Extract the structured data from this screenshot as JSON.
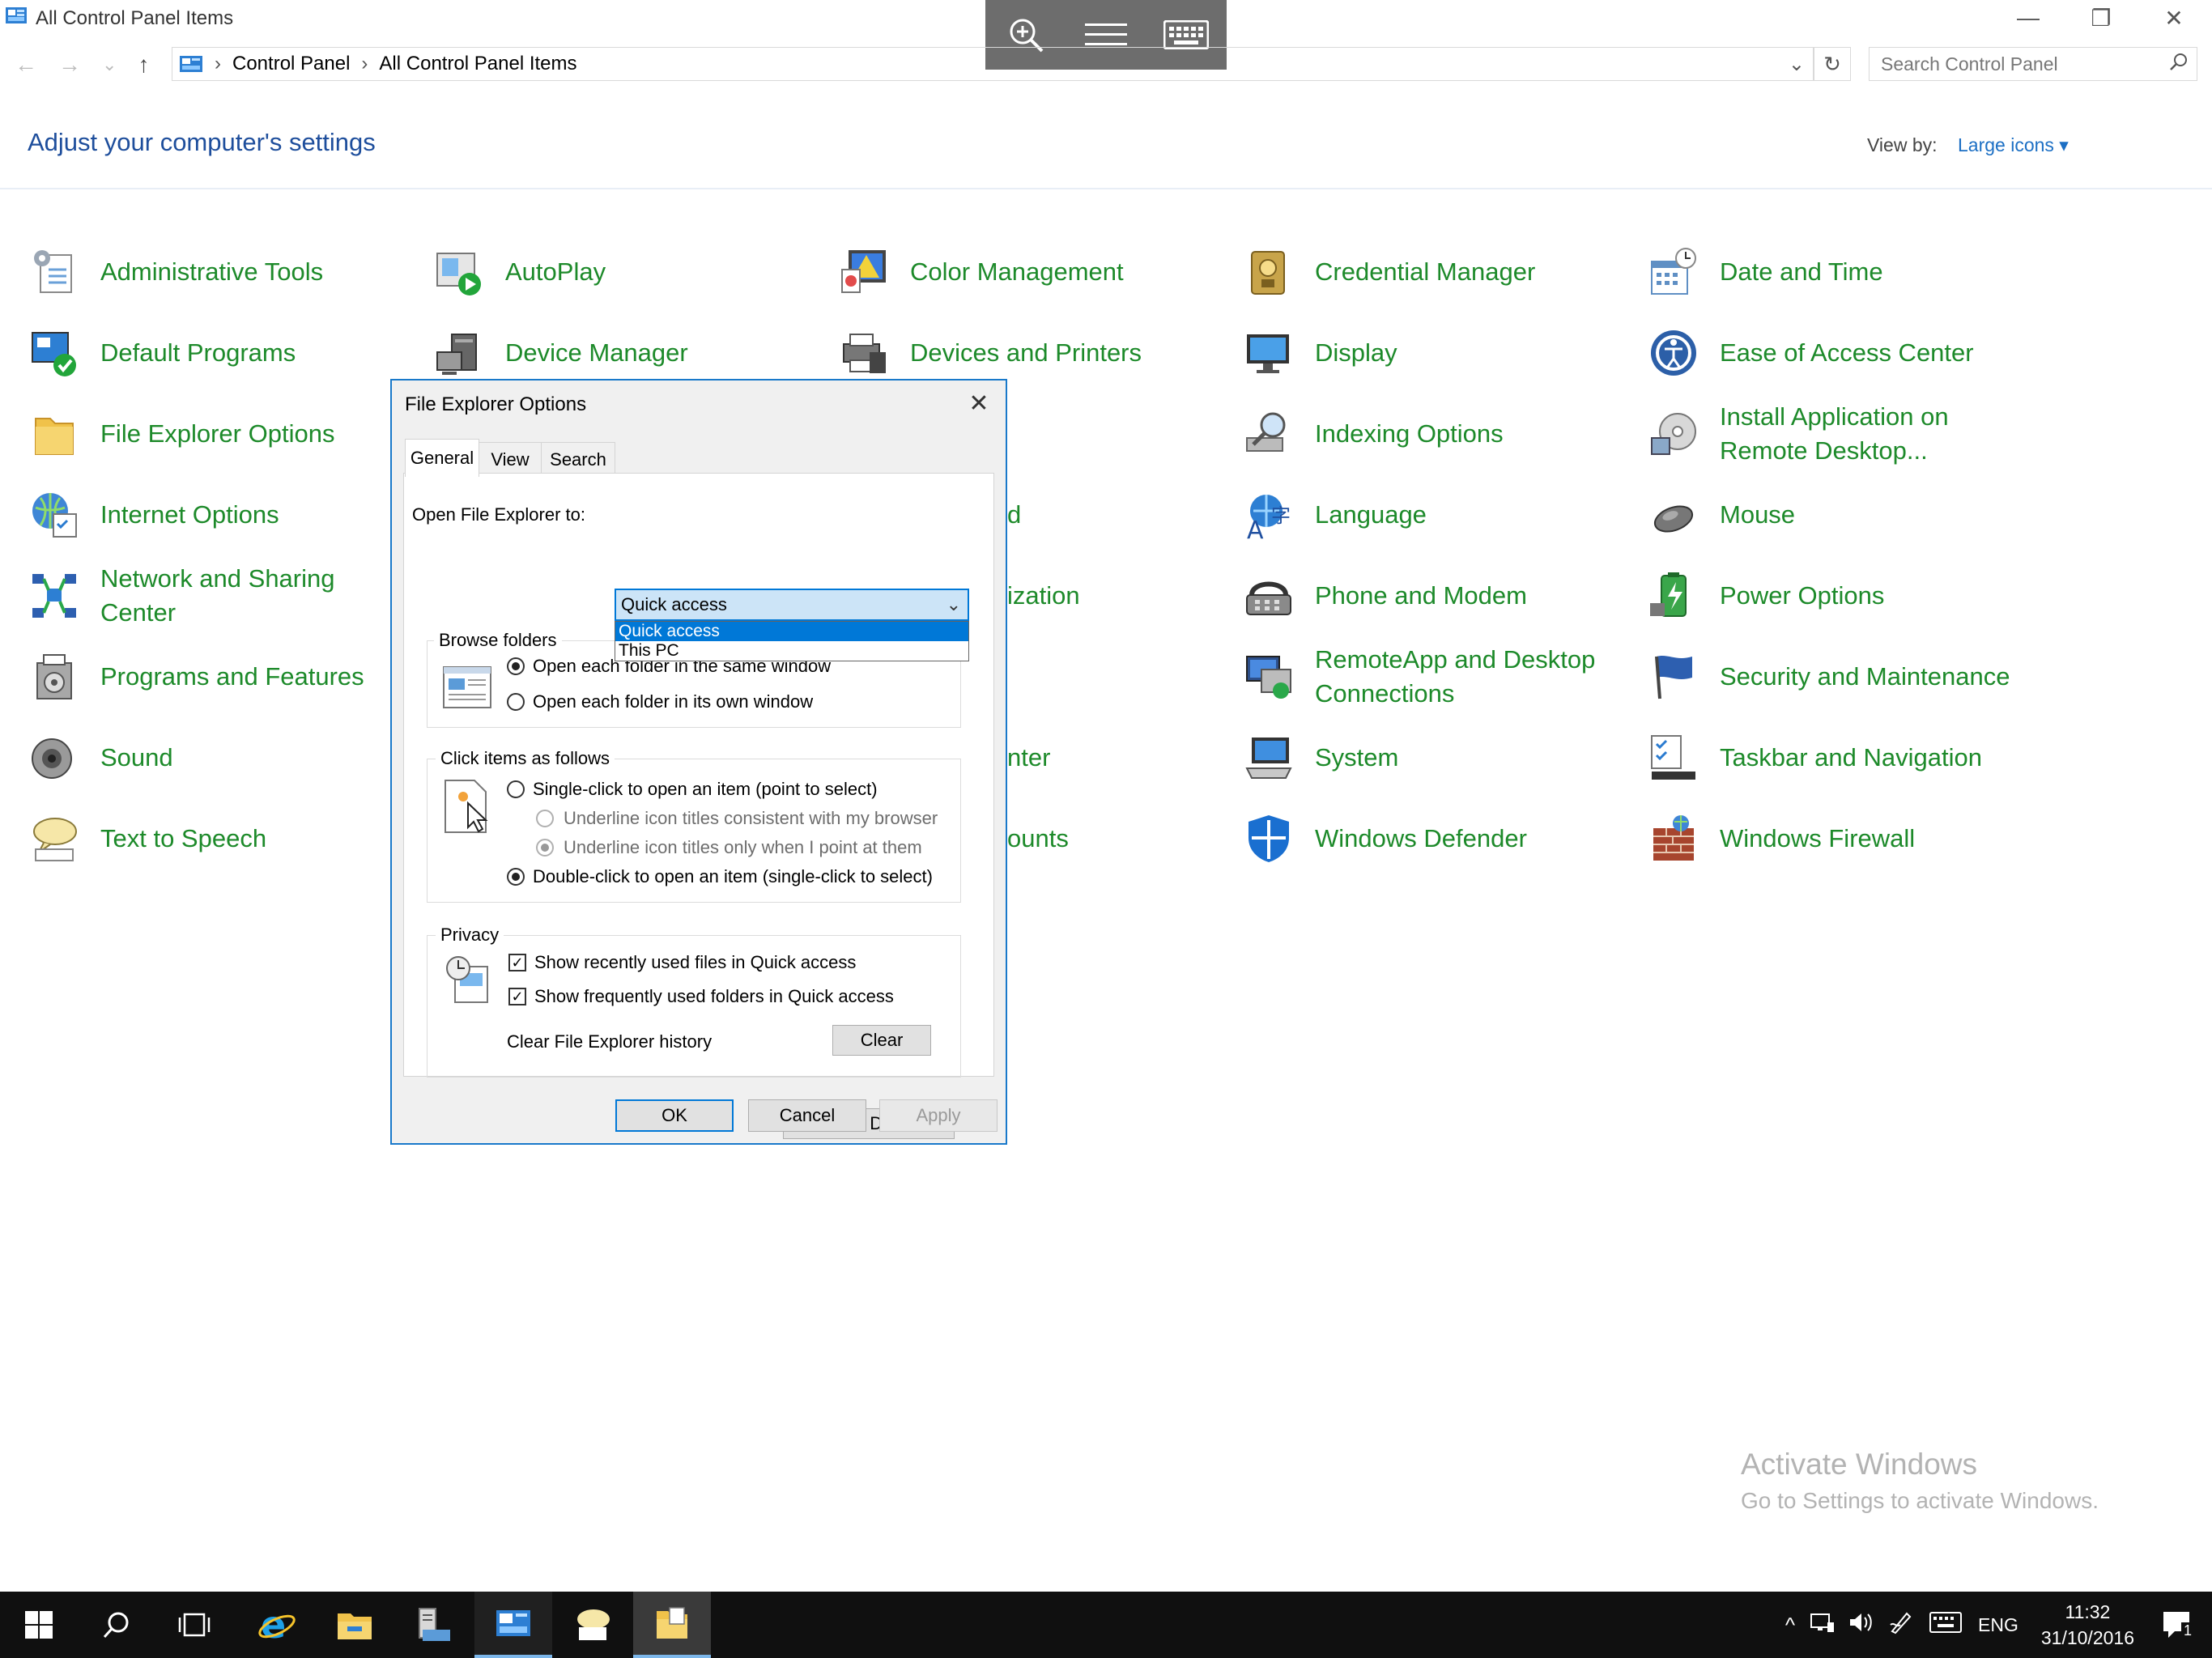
{
  "window": {
    "title": "All Control Panel Items",
    "minimize": "—",
    "restore": "❐",
    "close": "✕"
  },
  "address": {
    "back": "←",
    "forward": "→",
    "recent": "⌄",
    "up": "↑",
    "crumbs": [
      "Control Panel",
      "All Control Panel Items"
    ],
    "separator": "›",
    "dropdown": "⌄",
    "refresh": "↻",
    "search_placeholder": "Search Control Panel"
  },
  "header": {
    "title": "Adjust your computer's settings",
    "view_by_label": "View by:",
    "view_by_value": "Large icons ▾"
  },
  "items": [
    {
      "label": "Administrative Tools",
      "icon": "admin-tools-icon"
    },
    {
      "label": "AutoPlay",
      "icon": "autoplay-icon"
    },
    {
      "label": "Color Management",
      "icon": "color-management-icon"
    },
    {
      "label": "Credential Manager",
      "icon": "credential-manager-icon"
    },
    {
      "label": "Date and Time",
      "icon": "date-time-icon"
    },
    {
      "label": "Default Programs",
      "icon": "default-programs-icon"
    },
    {
      "label": "Device Manager",
      "icon": "device-manager-icon"
    },
    {
      "label": "Devices and Printers",
      "icon": "devices-printers-icon"
    },
    {
      "label": "Display",
      "icon": "display-icon"
    },
    {
      "label": "Ease of Access Center",
      "icon": "ease-of-access-icon"
    },
    {
      "label": "File Explorer Options",
      "icon": "file-explorer-options-icon"
    },
    {
      "label": "Indexing Options",
      "icon": "indexing-options-icon"
    },
    {
      "label": "Install Application on Remote Desktop...",
      "icon": "install-app-rd-icon"
    },
    {
      "label": "Internet Options",
      "icon": "internet-options-icon"
    },
    {
      "label": "d",
      "icon": ""
    },
    {
      "label": "Language",
      "icon": "language-icon"
    },
    {
      "label": "Mouse",
      "icon": "mouse-icon"
    },
    {
      "label": "Network and Sharing Center",
      "icon": "network-sharing-icon"
    },
    {
      "label": "ization",
      "icon": ""
    },
    {
      "label": "Phone and Modem",
      "icon": "phone-modem-icon"
    },
    {
      "label": "Power Options",
      "icon": "power-options-icon"
    },
    {
      "label": "Programs and Features",
      "icon": "programs-features-icon"
    },
    {
      "label": "RemoteApp and Desktop Connections",
      "icon": "remoteapp-icon"
    },
    {
      "label": "Security and Maintenance",
      "icon": "security-maintenance-icon"
    },
    {
      "label": "Sound",
      "icon": "sound-icon"
    },
    {
      "label": "nter",
      "icon": ""
    },
    {
      "label": "System",
      "icon": "system-icon"
    },
    {
      "label": "Taskbar and Navigation",
      "icon": "taskbar-navigation-icon"
    },
    {
      "label": "Text to Speech",
      "icon": "text-to-speech-icon"
    },
    {
      "label": "ounts",
      "icon": ""
    },
    {
      "label": "Windows Defender",
      "icon": "windows-defender-icon"
    },
    {
      "label": "Windows Firewall",
      "icon": "windows-firewall-icon"
    }
  ],
  "dialog": {
    "title": "File Explorer Options",
    "close": "✕",
    "tabs": [
      "General",
      "View",
      "Search"
    ],
    "open_to_label": "Open File Explorer to:",
    "open_to_value": "Quick access",
    "combo_arrow": "⌄",
    "open_to_options": [
      "Quick access",
      "This PC"
    ],
    "browse_folders": {
      "legend": "Browse folders",
      "opt_same": "Open each folder in the same window",
      "opt_own": "Open each folder in its own window"
    },
    "click_items": {
      "legend": "Click items as follows",
      "single": "Single-click to open an item (point to select)",
      "underline_browser": "Underline icon titles consistent with my browser",
      "underline_point": "Underline icon titles only when I point at them",
      "double": "Double-click to open an item (single-click to select)"
    },
    "privacy": {
      "legend": "Privacy",
      "recent_files": "Show recently used files in Quick access",
      "frequent_folders": "Show frequently used folders in Quick access",
      "clear_history_label": "Clear File Explorer history",
      "clear_button": "Clear",
      "checkmark": "✓"
    },
    "restore_defaults": "Restore Defaults",
    "ok": "OK",
    "cancel": "Cancel",
    "apply": "Apply"
  },
  "watermark": {
    "line1": "Activate Windows",
    "line2": "Go to Settings to activate Windows."
  },
  "taskbar": {
    "language": "ENG",
    "time": "11:32",
    "date": "31/10/2016",
    "notification_count": "1",
    "tray_chevron": "^"
  },
  "colors": {
    "accent": "#0078d7",
    "link_green": "#1d8a2a",
    "title_blue": "#1e4e9c",
    "taskbar": "#101010"
  }
}
